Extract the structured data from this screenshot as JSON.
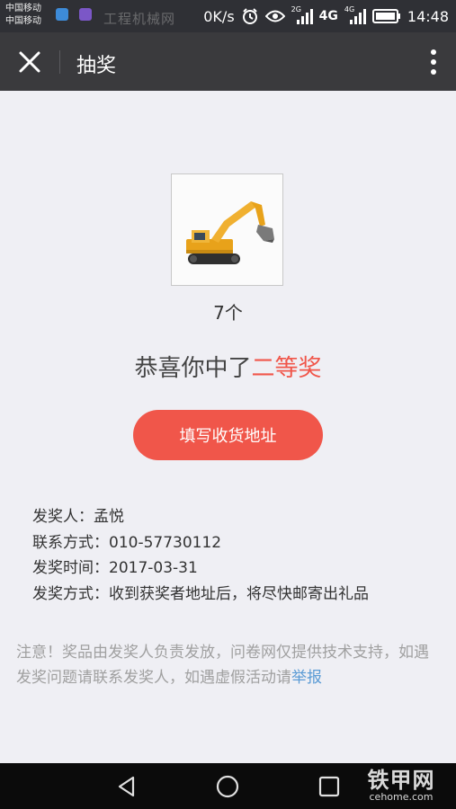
{
  "status_bar": {
    "carrier_1": "中国移动",
    "carrier_2": "中国移动",
    "watermark": "工程机械网",
    "speed": "0K/s",
    "net_1": "2G",
    "net_2": "4G",
    "net_3": "4G",
    "time": "14:48",
    "icons": [
      "alarm-clock-icon",
      "eye-icon",
      "signal-icon",
      "battery-icon"
    ]
  },
  "header": {
    "title": "抽奖",
    "close_icon": "close-icon",
    "more_icon": "more-vertical-icon"
  },
  "prize": {
    "image": "excavator",
    "quantity": "7个",
    "congrats_prefix": "恭喜你中了",
    "prize_level": "二等奖",
    "button_label": "填写收货地址"
  },
  "info": {
    "issuer_label": "发奖人：",
    "issuer": "孟悦",
    "contact_label": "联系方式：",
    "contact": "010-57730112",
    "date_label": "发奖时间：",
    "date": "2017-03-31",
    "method_label": "发奖方式：",
    "method": "收到获奖者地址后，将尽快邮寄出礼品"
  },
  "notice": {
    "text": "注意！奖品由发奖人负责发放，问卷网仅提供技术支持，如遇发奖问题请联系发奖人，如遇虚假活动请",
    "link": "举报"
  },
  "nav_bar": {
    "back_icon": "back-triangle-icon",
    "home_icon": "home-circle-icon",
    "recent_icon": "recent-square-icon",
    "watermark_big": "铁甲网",
    "watermark_small": "cehome.com"
  },
  "colors": {
    "accent": "#f0564a",
    "link": "#5b9bd5",
    "title_bar": "#3a3a3d",
    "background": "#efeff4"
  }
}
